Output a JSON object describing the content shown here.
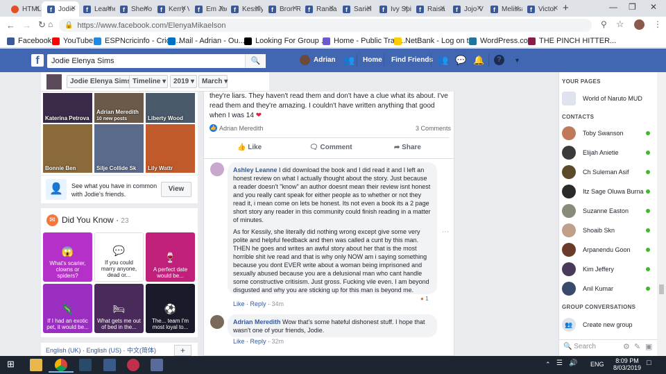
{
  "browser": {
    "tabs": [
      {
        "label": "HTML5",
        "icon": "html5-icon"
      },
      {
        "label": "Jodie",
        "icon": "facebook-icon",
        "active": true
      },
      {
        "label": "Leanne",
        "icon": "facebook-icon"
      },
      {
        "label": "Sherro",
        "icon": "facebook-icon"
      },
      {
        "label": "Kerry V",
        "icon": "facebook-icon"
      },
      {
        "label": "Em Jac",
        "icon": "facebook-icon"
      },
      {
        "label": "Kessily",
        "icon": "facebook-icon"
      },
      {
        "label": "Bron R",
        "icon": "facebook-icon"
      },
      {
        "label": "Randal",
        "icon": "facebook-icon"
      },
      {
        "label": "Sariel",
        "icon": "facebook-icon"
      },
      {
        "label": "Ivy Spi",
        "icon": "facebook-icon"
      },
      {
        "label": "Raisa",
        "icon": "facebook-icon"
      },
      {
        "label": "Jojo V",
        "icon": "facebook-icon"
      },
      {
        "label": "Melissa",
        "icon": "facebook-icon"
      },
      {
        "label": "Victor",
        "icon": "facebook-icon"
      }
    ],
    "url": "https://www.facebook.com/ElenyaMikaelson",
    "bookmarks": [
      {
        "label": "Facebook",
        "color": "#3b5998"
      },
      {
        "label": "YouTube",
        "color": "#ff0000"
      },
      {
        "label": "ESPNcricinfo - Crick...",
        "color": "#1e88e5"
      },
      {
        "label": "Mail - Adrian - Ou...",
        "color": "#0072c6"
      },
      {
        "label": "Looking For Group ...",
        "color": "#000000"
      },
      {
        "label": "Home - Public Tran...",
        "color": "#6a5acd"
      },
      {
        "label": "NetBank - Log on t...",
        "color": "#ffcc00"
      },
      {
        "label": "WordPress.com",
        "color": "#21759b"
      },
      {
        "label": "THE PINCH HITTER...",
        "color": "#8b1a4a"
      }
    ]
  },
  "fb": {
    "search_value": "Jodie Elenya Sims",
    "user_name": "Adrian",
    "nav_home": "Home",
    "nav_find_friends": "Find Friends"
  },
  "timeline_nav": {
    "name": "Jodie Elenya Sims",
    "timeline": "Timeline",
    "year": "2019",
    "month": "March"
  },
  "friends": [
    {
      "name": "Katerina Petrova",
      "color": "#3a2a4a"
    },
    {
      "name": "Adrian Meredith",
      "sub": "10 new posts",
      "color": "#6b5a4a"
    },
    {
      "name": "Liberty Wood",
      "color": "#4a5a6a"
    },
    {
      "name": "Bonnie Ben",
      "color": "#8a6a3a"
    },
    {
      "name": "Silje Collide Sk",
      "color": "#5a6a8a"
    },
    {
      "name": "Lily Wattr",
      "color": "#c05a2a"
    }
  ],
  "common_text": "See what you have in common with Jodie's friends.",
  "view_label": "View",
  "did_you_know": {
    "title": "Did You Know",
    "count": "23",
    "cards": [
      {
        "text": "What's scarier, clowns or spiders?",
        "color": "#b530c8"
      },
      {
        "text": "If you could marry anyone, dead or...",
        "color": "#ffffff"
      },
      {
        "text": "A perfect date would be...",
        "color": "#c0207a"
      },
      {
        "text": "If I had an exotic pet, it would be...",
        "color": "#9a2ec0"
      },
      {
        "text": "What gets me out of bed in the...",
        "color": "#4a2a5a"
      },
      {
        "text": "The... team I'm most loyal to...",
        "color": "#1a1a2a"
      }
    ]
  },
  "languages": "English (UK) · English (US) · 中文(简体)",
  "post": {
    "text": "they're liars. They haven't read them and don't have a clue what its about. I've read them and they're amazing. I couldn't have written anything that good when I was 14",
    "liker": "Adrian Meredith",
    "comments_count": "3 Comments",
    "like": "Like",
    "comment": "Comment",
    "share": "Share"
  },
  "comments": [
    {
      "author": "Ashley Leanne",
      "text1": "I did download the book and I did read it and I left an honest review on what I actually thought about the story. Just because a reader doesn't \"know\" an author doesnt mean their review isnt honest and you really cant speak for either people as to whether or not they read it, i mean come on lets be honest. Its not even a book its a 2 page short story any reader in this community could finish reading in a matter of minutes.",
      "text2": "As for Kessily, she literally did nothing wrong except give some very polite and helpful feedback and then was called a cunt by this man. THEN he goes and writes an awful story about her that is the most horrible shit ive read and that is why only NOW am i saying something because you dont EVER write about a woman being imprisoned and sexually abused because you are a delusional man who cant handle some constructive critisism. Just gross. Fucking vile even. I am beyond disgusted and why you are sticking up for this man is beyond me.",
      "like": "Like",
      "reply": "Reply",
      "time": "34m",
      "reactions": "1"
    },
    {
      "author": "Adrian Meredith",
      "text1": "Wow that's some hateful dishonest stuff. I hope that wasn't one of your friends, Jodie.",
      "like": "Like",
      "reply": "Reply",
      "time": "32m"
    }
  ],
  "right_sidebar": {
    "your_pages": "YOUR PAGES",
    "page_name": "World of Naruto MUD",
    "contacts_title": "CONTACTS",
    "contacts": [
      "Toby Swanson",
      "Elijah Anietie",
      "Ch Suleman Asif",
      "Itz Sage Oluwa Burna",
      "Suzanne Easton",
      "Shoaib Skn",
      "Arpanendu Goon",
      "Kim Jeffery",
      "Anil Kumar"
    ],
    "group_conv": "GROUP CONVERSATIONS",
    "create_group": "Create new group",
    "search_placeholder": "Search"
  },
  "taskbar": {
    "time": "8:09 PM",
    "date": "8/03/2019",
    "lang": "ENG"
  }
}
